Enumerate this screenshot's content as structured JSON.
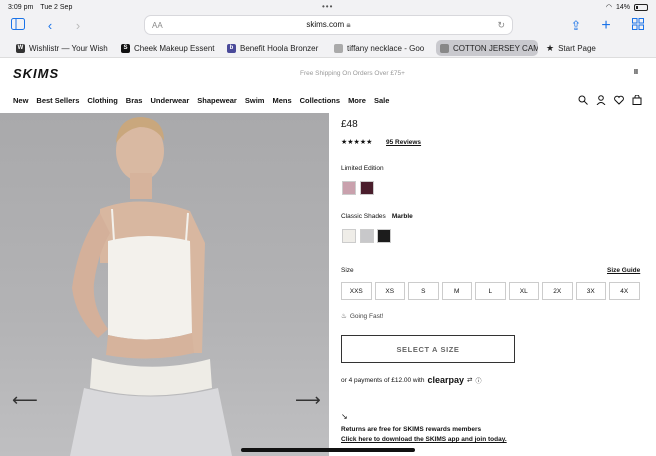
{
  "status": {
    "time": "3:09 pm",
    "date": "Tue 2 Sep",
    "battery": "14%"
  },
  "browser": {
    "aa": "AA",
    "url": "skims.com",
    "tabs": [
      {
        "label": "Wishlistr — Your Wish",
        "fav_letter": "W",
        "fav_color": "#333"
      },
      {
        "label": "Cheek Makeup Essent",
        "fav_letter": "S",
        "fav_color": "#111"
      },
      {
        "label": "Benefit Hoola Bronzer",
        "fav_letter": "b",
        "fav_color": "#4a4a9a"
      },
      {
        "label": "tiffany necklace - Goo",
        "fav_letter": "",
        "fav_color": "#aaa"
      },
      {
        "label": "COTTON JERSEY CAM",
        "fav_letter": "",
        "fav_color": "#888"
      },
      {
        "label": "Start Page",
        "fav_letter": "★",
        "fav_color": "#222"
      }
    ]
  },
  "site": {
    "logo": "SKIMS",
    "promo": "Free Shipping On Orders Over £75+",
    "pause": "II",
    "nav": [
      "New",
      "Best Sellers",
      "Clothing",
      "Bras",
      "Underwear",
      "Shapewear",
      "Swim",
      "Mens",
      "Collections",
      "More",
      "Sale"
    ]
  },
  "product": {
    "price": "£48",
    "stars": "★★★★★",
    "reviews": "95 Reviews",
    "limited_label": "Limited Edition",
    "limited_swatches": [
      "#c9a1ad",
      "#4a1e2c"
    ],
    "classic_label": "Classic Shades",
    "classic_selected": "Marble",
    "classic_swatches": [
      "#efede8",
      "#c8c8ca",
      "#1c1c1c"
    ],
    "size_label": "Size",
    "size_guide": "Size Guide",
    "sizes": [
      "XXS",
      "XS",
      "S",
      "M",
      "L",
      "XL",
      "2X",
      "3X",
      "4X"
    ],
    "going_fast": "Going Fast!",
    "select_size": "SELECT A SIZE",
    "pay_text": "or 4 payments of £12.00 with",
    "clearpay": "clearpay",
    "returns_line1": "Returns are free for SKIMS rewards members",
    "returns_line2": "Click here to download the SKIMS app and join today."
  }
}
